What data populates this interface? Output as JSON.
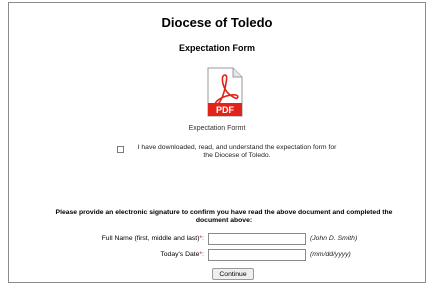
{
  "form": {
    "title": "Diocese of Toledo",
    "subtitle": "Expectation Form",
    "pdf_icon_label": "PDF",
    "pdf_caption": "Expectation Formt",
    "agree_text": "I have downloaded, read, and understand the expectation form for the Diocese of Toledo.",
    "signature_instructions": "Please provide an electronic signature to confirm you have read the above document and completed the document above:",
    "full_name": {
      "label": "Full Name (first, middle and last)",
      "required_mark": "*:",
      "value": "",
      "hint": "(John D. Smith)"
    },
    "date": {
      "label": "Today's Date",
      "required_mark": "*:",
      "value": "",
      "hint": "(mm/dd/yyyy)"
    },
    "continue_label": "Continue"
  },
  "colors": {
    "pdf_red": "#e2231a",
    "required": "#cc0000",
    "border": "#8c8c8c"
  }
}
